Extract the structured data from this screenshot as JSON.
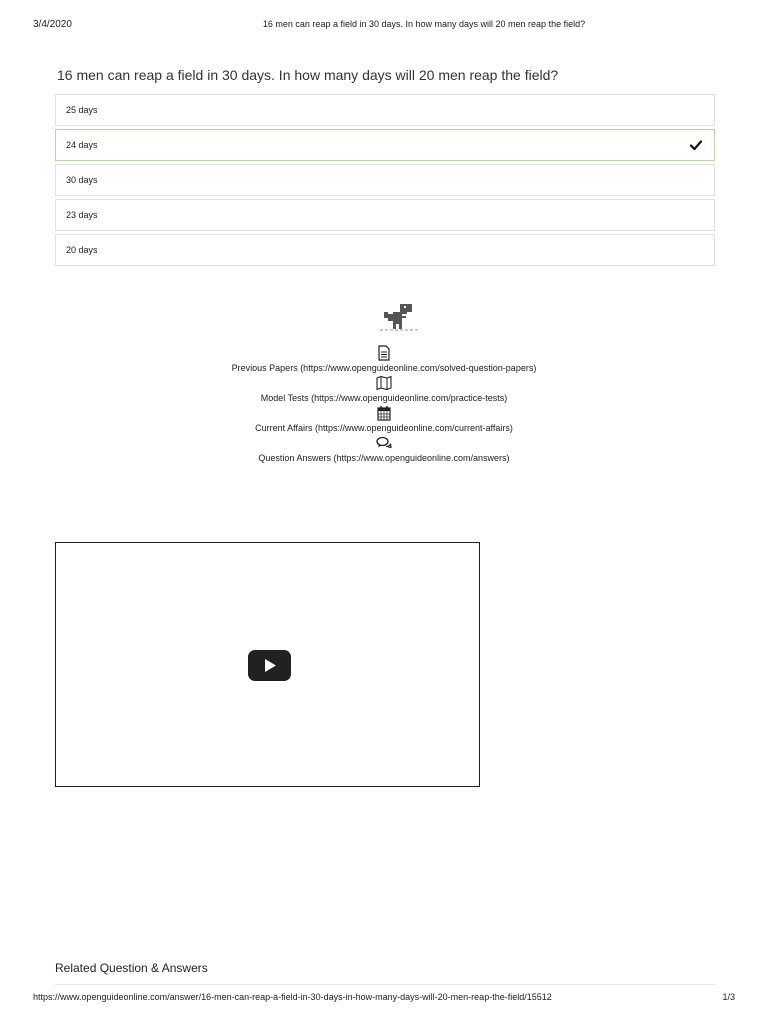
{
  "header": {
    "date": "3/4/2020",
    "title": "16 men can reap a field in 30 days. In how many days will 20 men reap the field?"
  },
  "question": {
    "text": "16 men can reap a field in 30 days. In how many days will 20 men reap the field?",
    "options": [
      {
        "label": "25 days",
        "correct": false
      },
      {
        "label": "24 days",
        "correct": true
      },
      {
        "label": "30 days",
        "correct": false
      },
      {
        "label": "23 days",
        "correct": false
      },
      {
        "label": "20 days",
        "correct": false
      }
    ]
  },
  "links": [
    {
      "icon": "document-icon",
      "text": "Previous Papers (https://www.openguideonline.com/solved-question-papers)"
    },
    {
      "icon": "map-icon",
      "text": "Model Tests (https://www.openguideonline.com/practice-tests)"
    },
    {
      "icon": "calendar-icon",
      "text": "Current Affairs (https://www.openguideonline.com/current-affairs)"
    },
    {
      "icon": "chat-icon",
      "text": "Question Answers (https://www.openguideonline.com/answers)"
    }
  ],
  "related": {
    "title": "Related Question & Answers"
  },
  "footer": {
    "url": "https://www.openguideonline.com/answer/16-men-can-reap-a-field-in-30-days-in-how-many-days-will-20-men-reap-the-field/15512",
    "page": "1/3"
  }
}
